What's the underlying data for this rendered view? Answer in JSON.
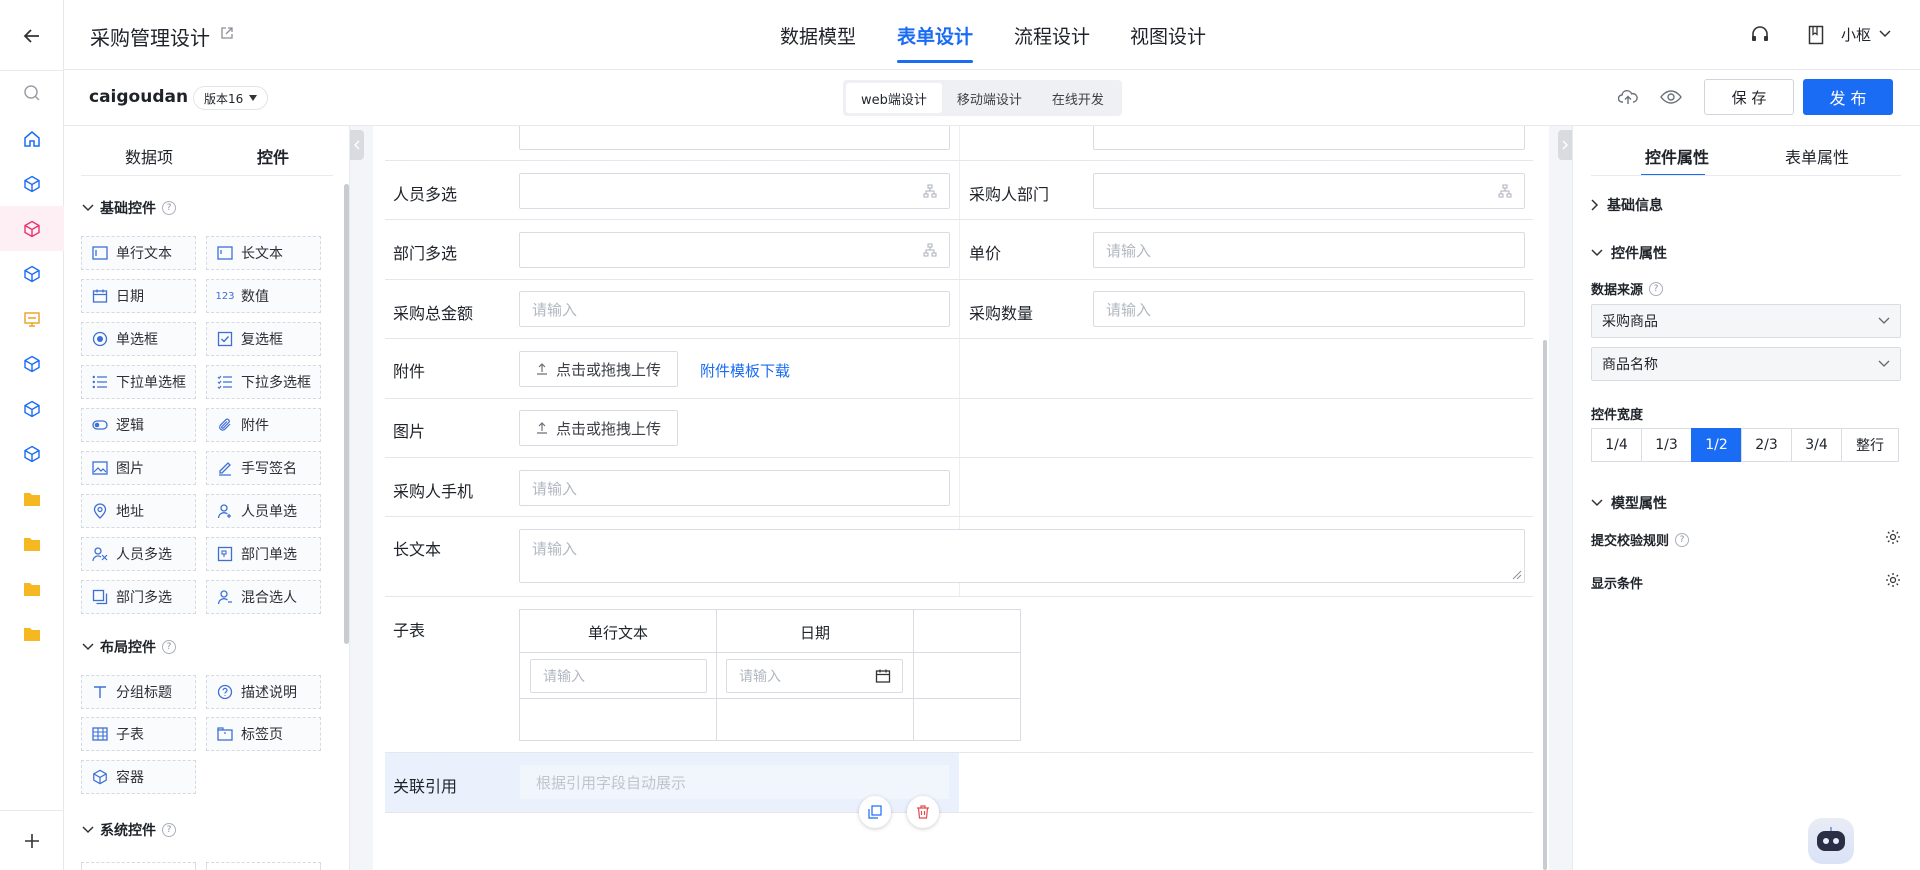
{
  "header": {
    "app_title": "采购管理设计",
    "tabs": [
      "数据模型",
      "表单设计",
      "流程设计",
      "视图设计"
    ],
    "active_tab": "表单设计",
    "user": "小枢"
  },
  "subbar": {
    "form_name": "caigoudan",
    "version": "版本16",
    "modes": [
      "web端设计",
      "移动端设计",
      "在线开发"
    ],
    "active_mode": "web端设计",
    "save": "保 存",
    "publish": "发 布"
  },
  "left": {
    "tabs": [
      "数据项",
      "控件"
    ],
    "active_tab": "控件",
    "basic_title": "基础控件",
    "basic": [
      "单行文本",
      "长文本",
      "日期",
      "数值",
      "单选框",
      "复选框",
      "下拉单选框",
      "下拉多选框",
      "逻辑",
      "附件",
      "图片",
      "手写签名",
      "地址",
      "人员单选",
      "人员多选",
      "部门单选",
      "部门多选",
      "混合选人"
    ],
    "layout_title": "布局控件",
    "layout": [
      "分组标题",
      "描述说明",
      "子表",
      "标签页",
      "容器"
    ],
    "system_title": "系统控件"
  },
  "form": {
    "placeholder": "请输入",
    "person_multi": "人员多选",
    "buyer_dept": "采购人部门",
    "dept_multi": "部门多选",
    "unit_price": "单价",
    "total_amount": "采购总金额",
    "quantity": "采购数量",
    "attachment": "附件",
    "upload_label": "点击或拖拽上传",
    "template_link": "附件模板下载",
    "image": "图片",
    "buyer_phone": "采购人手机",
    "long_text": "长文本",
    "subtable": "子表",
    "sub_cols": [
      "单行文本",
      "日期"
    ],
    "ref": "关联引用",
    "ref_hint": "根据引用字段自动展示"
  },
  "right": {
    "tabs": [
      "控件属性",
      "表单属性"
    ],
    "active_tab": "控件属性",
    "basic_info": "基础信息",
    "ctl_props": "控件属性",
    "data_source": "数据来源",
    "source_value": "采购商品",
    "field_value": "商品名称",
    "width_label": "控件宽度",
    "widths": [
      "1/4",
      "1/3",
      "1/2",
      "2/3",
      "3/4",
      "整行"
    ],
    "active_width": "1/2",
    "model_props": "模型属性",
    "validate": "提交校验规则",
    "display": "显示条件"
  },
  "colors": {
    "accent": "#1a6cf5",
    "active_rail": "#e8336d"
  }
}
